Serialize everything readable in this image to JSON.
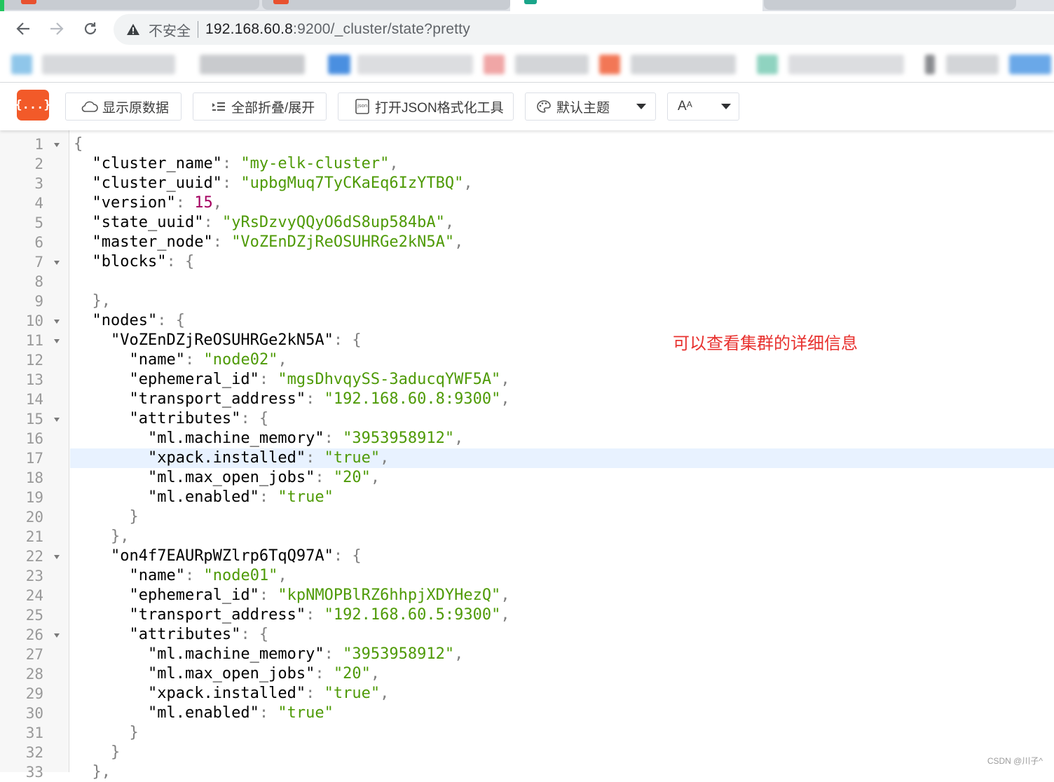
{
  "browser": {
    "insecure_label": "不安全",
    "url_host": "192.168.60.8",
    "url_rest": ":9200/_cluster/state?pretty"
  },
  "viewer": {
    "logo_text": "{...}",
    "buttons": {
      "raw": "显示原数据",
      "fold": "全部折叠/展开",
      "formatter": "打开JSON格式化工具",
      "theme": "默认主题",
      "font": "A"
    }
  },
  "code_lines": [
    {
      "n": "1",
      "fold": true,
      "indent": 0,
      "tokens": [
        {
          "t": "p",
          "v": "{"
        }
      ]
    },
    {
      "n": "2",
      "indent": 1,
      "tokens": [
        {
          "t": "k",
          "v": "\"cluster_name\""
        },
        {
          "t": "p",
          "v": ": "
        },
        {
          "t": "s",
          "v": "\"my-elk-cluster\""
        },
        {
          "t": "p",
          "v": ","
        }
      ]
    },
    {
      "n": "3",
      "indent": 1,
      "tokens": [
        {
          "t": "k",
          "v": "\"cluster_uuid\""
        },
        {
          "t": "p",
          "v": ": "
        },
        {
          "t": "s",
          "v": "\"upbgMuq7TyCKaEq6IzYTBQ\""
        },
        {
          "t": "p",
          "v": ","
        }
      ]
    },
    {
      "n": "4",
      "indent": 1,
      "tokens": [
        {
          "t": "k",
          "v": "\"version\""
        },
        {
          "t": "p",
          "v": ": "
        },
        {
          "t": "n",
          "v": "15"
        },
        {
          "t": "p",
          "v": ","
        }
      ]
    },
    {
      "n": "5",
      "indent": 1,
      "tokens": [
        {
          "t": "k",
          "v": "\"state_uuid\""
        },
        {
          "t": "p",
          "v": ": "
        },
        {
          "t": "s",
          "v": "\"yRsDzvyQQyO6dS8up584bA\""
        },
        {
          "t": "p",
          "v": ","
        }
      ]
    },
    {
      "n": "6",
      "indent": 1,
      "tokens": [
        {
          "t": "k",
          "v": "\"master_node\""
        },
        {
          "t": "p",
          "v": ": "
        },
        {
          "t": "s",
          "v": "\"VoZEnDZjReOSUHRGe2kN5A\""
        },
        {
          "t": "p",
          "v": ","
        }
      ]
    },
    {
      "n": "7",
      "fold": true,
      "indent": 1,
      "tokens": [
        {
          "t": "k",
          "v": "\"blocks\""
        },
        {
          "t": "p",
          "v": ": {"
        }
      ]
    },
    {
      "n": "8",
      "indent": 0,
      "tokens": []
    },
    {
      "n": "9",
      "indent": 1,
      "tokens": [
        {
          "t": "p",
          "v": "},"
        }
      ]
    },
    {
      "n": "10",
      "fold": true,
      "indent": 1,
      "tokens": [
        {
          "t": "k",
          "v": "\"nodes\""
        },
        {
          "t": "p",
          "v": ": {"
        }
      ]
    },
    {
      "n": "11",
      "fold": true,
      "indent": 2,
      "tokens": [
        {
          "t": "k",
          "v": "\"VoZEnDZjReOSUHRGe2kN5A\""
        },
        {
          "t": "p",
          "v": ": {"
        }
      ]
    },
    {
      "n": "12",
      "indent": 3,
      "tokens": [
        {
          "t": "k",
          "v": "\"name\""
        },
        {
          "t": "p",
          "v": ": "
        },
        {
          "t": "s",
          "v": "\"node02\""
        },
        {
          "t": "p",
          "v": ","
        }
      ]
    },
    {
      "n": "13",
      "indent": 3,
      "tokens": [
        {
          "t": "k",
          "v": "\"ephemeral_id\""
        },
        {
          "t": "p",
          "v": ": "
        },
        {
          "t": "s",
          "v": "\"mgsDhvqySS-3aducqYWF5A\""
        },
        {
          "t": "p",
          "v": ","
        }
      ]
    },
    {
      "n": "14",
      "indent": 3,
      "tokens": [
        {
          "t": "k",
          "v": "\"transport_address\""
        },
        {
          "t": "p",
          "v": ": "
        },
        {
          "t": "s",
          "v": "\"192.168.60.8:9300\""
        },
        {
          "t": "p",
          "v": ","
        }
      ]
    },
    {
      "n": "15",
      "fold": true,
      "indent": 3,
      "tokens": [
        {
          "t": "k",
          "v": "\"attributes\""
        },
        {
          "t": "p",
          "v": ": {"
        }
      ]
    },
    {
      "n": "16",
      "indent": 4,
      "tokens": [
        {
          "t": "k",
          "v": "\"ml.machine_memory\""
        },
        {
          "t": "p",
          "v": ": "
        },
        {
          "t": "s",
          "v": "\"3953958912\""
        },
        {
          "t": "p",
          "v": ","
        }
      ]
    },
    {
      "n": "17",
      "hl": true,
      "indent": 4,
      "tokens": [
        {
          "t": "k",
          "v": "\"xpack.installed\""
        },
        {
          "t": "p",
          "v": ": "
        },
        {
          "t": "s",
          "v": "\"true\""
        },
        {
          "t": "p",
          "v": ","
        }
      ]
    },
    {
      "n": "18",
      "indent": 4,
      "tokens": [
        {
          "t": "k",
          "v": "\"ml.max_open_jobs\""
        },
        {
          "t": "p",
          "v": ": "
        },
        {
          "t": "s",
          "v": "\"20\""
        },
        {
          "t": "p",
          "v": ","
        }
      ]
    },
    {
      "n": "19",
      "indent": 4,
      "tokens": [
        {
          "t": "k",
          "v": "\"ml.enabled\""
        },
        {
          "t": "p",
          "v": ": "
        },
        {
          "t": "s",
          "v": "\"true\""
        }
      ]
    },
    {
      "n": "20",
      "indent": 3,
      "tokens": [
        {
          "t": "p",
          "v": "}"
        }
      ]
    },
    {
      "n": "21",
      "indent": 2,
      "tokens": [
        {
          "t": "p",
          "v": "},"
        }
      ]
    },
    {
      "n": "22",
      "fold": true,
      "indent": 2,
      "tokens": [
        {
          "t": "k",
          "v": "\"on4f7EAURpWZlrp6TqQ97A\""
        },
        {
          "t": "p",
          "v": ": {"
        }
      ]
    },
    {
      "n": "23",
      "indent": 3,
      "tokens": [
        {
          "t": "k",
          "v": "\"name\""
        },
        {
          "t": "p",
          "v": ": "
        },
        {
          "t": "s",
          "v": "\"node01\""
        },
        {
          "t": "p",
          "v": ","
        }
      ]
    },
    {
      "n": "24",
      "indent": 3,
      "tokens": [
        {
          "t": "k",
          "v": "\"ephemeral_id\""
        },
        {
          "t": "p",
          "v": ": "
        },
        {
          "t": "s",
          "v": "\"kpNMOPBlRZ6hhpjXDYHezQ\""
        },
        {
          "t": "p",
          "v": ","
        }
      ]
    },
    {
      "n": "25",
      "indent": 3,
      "tokens": [
        {
          "t": "k",
          "v": "\"transport_address\""
        },
        {
          "t": "p",
          "v": ": "
        },
        {
          "t": "s",
          "v": "\"192.168.60.5:9300\""
        },
        {
          "t": "p",
          "v": ","
        }
      ]
    },
    {
      "n": "26",
      "fold": true,
      "indent": 3,
      "tokens": [
        {
          "t": "k",
          "v": "\"attributes\""
        },
        {
          "t": "p",
          "v": ": {"
        }
      ]
    },
    {
      "n": "27",
      "indent": 4,
      "tokens": [
        {
          "t": "k",
          "v": "\"ml.machine_memory\""
        },
        {
          "t": "p",
          "v": ": "
        },
        {
          "t": "s",
          "v": "\"3953958912\""
        },
        {
          "t": "p",
          "v": ","
        }
      ]
    },
    {
      "n": "28",
      "indent": 4,
      "tokens": [
        {
          "t": "k",
          "v": "\"ml.max_open_jobs\""
        },
        {
          "t": "p",
          "v": ": "
        },
        {
          "t": "s",
          "v": "\"20\""
        },
        {
          "t": "p",
          "v": ","
        }
      ]
    },
    {
      "n": "29",
      "indent": 4,
      "tokens": [
        {
          "t": "k",
          "v": "\"xpack.installed\""
        },
        {
          "t": "p",
          "v": ": "
        },
        {
          "t": "s",
          "v": "\"true\""
        },
        {
          "t": "p",
          "v": ","
        }
      ]
    },
    {
      "n": "30",
      "indent": 4,
      "tokens": [
        {
          "t": "k",
          "v": "\"ml.enabled\""
        },
        {
          "t": "p",
          "v": ": "
        },
        {
          "t": "s",
          "v": "\"true\""
        }
      ]
    },
    {
      "n": "31",
      "indent": 3,
      "tokens": [
        {
          "t": "p",
          "v": "}"
        }
      ]
    },
    {
      "n": "32",
      "indent": 2,
      "tokens": [
        {
          "t": "p",
          "v": "}"
        }
      ]
    },
    {
      "n": "33",
      "indent": 1,
      "tokens": [
        {
          "t": "p",
          "v": "},"
        }
      ]
    }
  ],
  "annotation": "可以查看集群的详细信息",
  "watermark": "CSDN @川子^",
  "colors": {
    "string": "#4e9a06",
    "number": "#a40060",
    "punct": "#808080",
    "highlight_line": "#e8f2ff",
    "logo": "#f25a29",
    "annotation": "#e8322f"
  }
}
